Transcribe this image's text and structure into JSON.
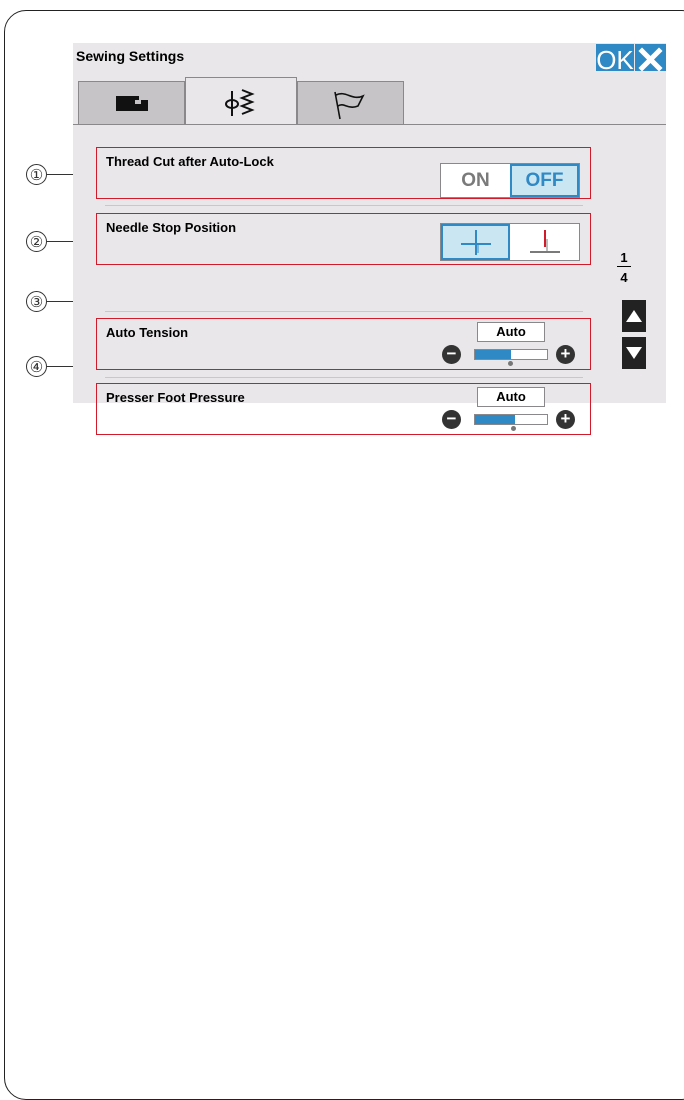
{
  "window": {
    "title": "Sewing Settings",
    "ok_label": "OK"
  },
  "tabs": [
    {
      "name": "machine-settings",
      "icon": "sewing-machine-icon",
      "active": false
    },
    {
      "name": "sewing-settings",
      "icon": "stitch-icon",
      "active": true
    },
    {
      "name": "language-settings",
      "icon": "flag-icon",
      "active": false
    }
  ],
  "callouts": [
    "①",
    "②",
    "③",
    "④"
  ],
  "settings": {
    "thread_cut": {
      "label": "Thread Cut after Auto-Lock",
      "on_label": "ON",
      "off_label": "OFF",
      "selected": "OFF"
    },
    "needle_stop": {
      "label": "Needle Stop Position",
      "options": [
        "needle-up-icon",
        "needle-down-icon"
      ],
      "selected": "needle-up-icon"
    },
    "auto_tension": {
      "label": "Auto Tension",
      "value": "Auto",
      "level": 0.5
    },
    "presser_foot": {
      "label": "Presser Foot Pressure",
      "value": "Auto",
      "level": 0.56
    }
  },
  "pager": {
    "current": "1",
    "total": "4"
  },
  "colors": {
    "accent": "#2f89c5",
    "highlight_border": "#d21b2a",
    "panel_bg": "#e9e7ea"
  }
}
